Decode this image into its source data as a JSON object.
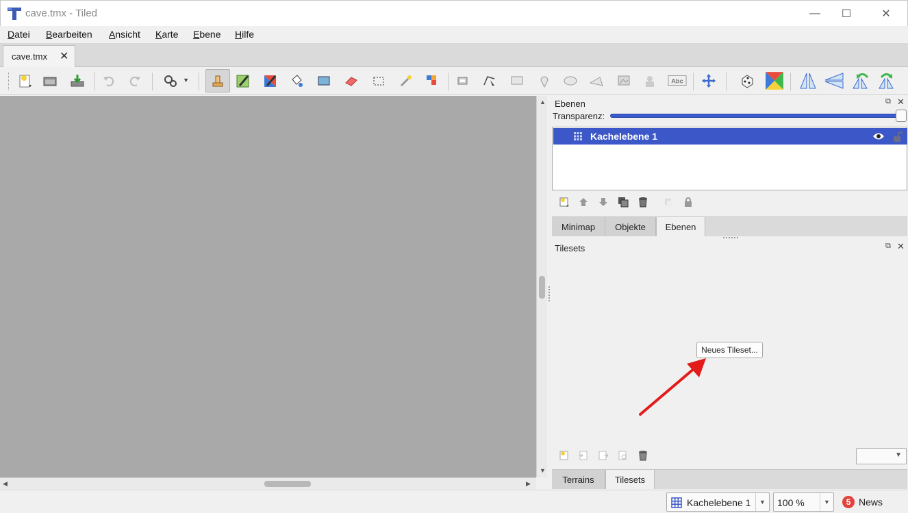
{
  "window": {
    "title": "cave.tmx - Tiled",
    "minimize_glyph": "—",
    "maximize_glyph": "☐",
    "close_glyph": "✕"
  },
  "menu": {
    "items": [
      {
        "label_ul": "D",
        "label_rest": "atei"
      },
      {
        "label_ul": "B",
        "label_rest": "earbeiten"
      },
      {
        "label_ul": "A",
        "label_rest": "nsicht"
      },
      {
        "label_ul": "K",
        "label_rest": "arte"
      },
      {
        "label_ul": "E",
        "label_rest": "bene"
      },
      {
        "label_ul": "H",
        "label_rest": "ilfe"
      }
    ]
  },
  "document_tab": {
    "label": "cave.tmx",
    "close_glyph": "✕"
  },
  "toolbar": {
    "icons": [
      "new-map-icon",
      "open-icon",
      "save-icon",
      "undo-icon",
      "redo-icon",
      "commands-icon",
      "stamp-brush-icon",
      "terrain-brush-icon",
      "wang-brush-icon",
      "bucket-fill-icon",
      "shape-fill-icon",
      "eraser-icon",
      "rect-select-icon",
      "magic-wand-icon",
      "select-same-tile-icon",
      "select-objects-icon",
      "edit-polygons-icon",
      "insert-rectangle-icon",
      "insert-point-icon",
      "insert-ellipse-icon",
      "insert-polygon-icon",
      "insert-tile-icon",
      "insert-template-icon",
      "insert-text-icon",
      "layer-offset-icon",
      "random-mode-icon",
      "wang-fill-icon",
      "flip-horizontal-icon",
      "flip-vertical-icon",
      "rotate-left-icon",
      "rotate-right-icon"
    ],
    "text_tool_label": "Abc"
  },
  "layers_panel": {
    "title": "Ebenen",
    "opacity_label": "Transparenz:",
    "opacity": 1.0,
    "layers": [
      {
        "name": "Kachelebene 1",
        "visible": true,
        "locked": false,
        "selected": true
      }
    ]
  },
  "layers_tabs": [
    {
      "label": "Minimap",
      "current": false
    },
    {
      "label": "Objekte",
      "current": false
    },
    {
      "label": "Ebenen",
      "current": true
    }
  ],
  "tilesets_panel": {
    "title": "Tilesets",
    "new_tileset_label": "Neues Tileset...",
    "tileset_combo_value": ""
  },
  "tilesets_tabs": [
    {
      "label": "Terrains",
      "current": false
    },
    {
      "label": "Tilesets",
      "current": true
    }
  ],
  "statusbar": {
    "layer_combo": "Kachelebene 1",
    "zoom_combo": "100 %",
    "news_count": "5",
    "news_label": "News"
  },
  "colors": {
    "selection": "#3c58c8",
    "canvas": "#a9a9a9",
    "annotation_arrow": "#e21b1b",
    "news_badge": "#e2423a"
  }
}
